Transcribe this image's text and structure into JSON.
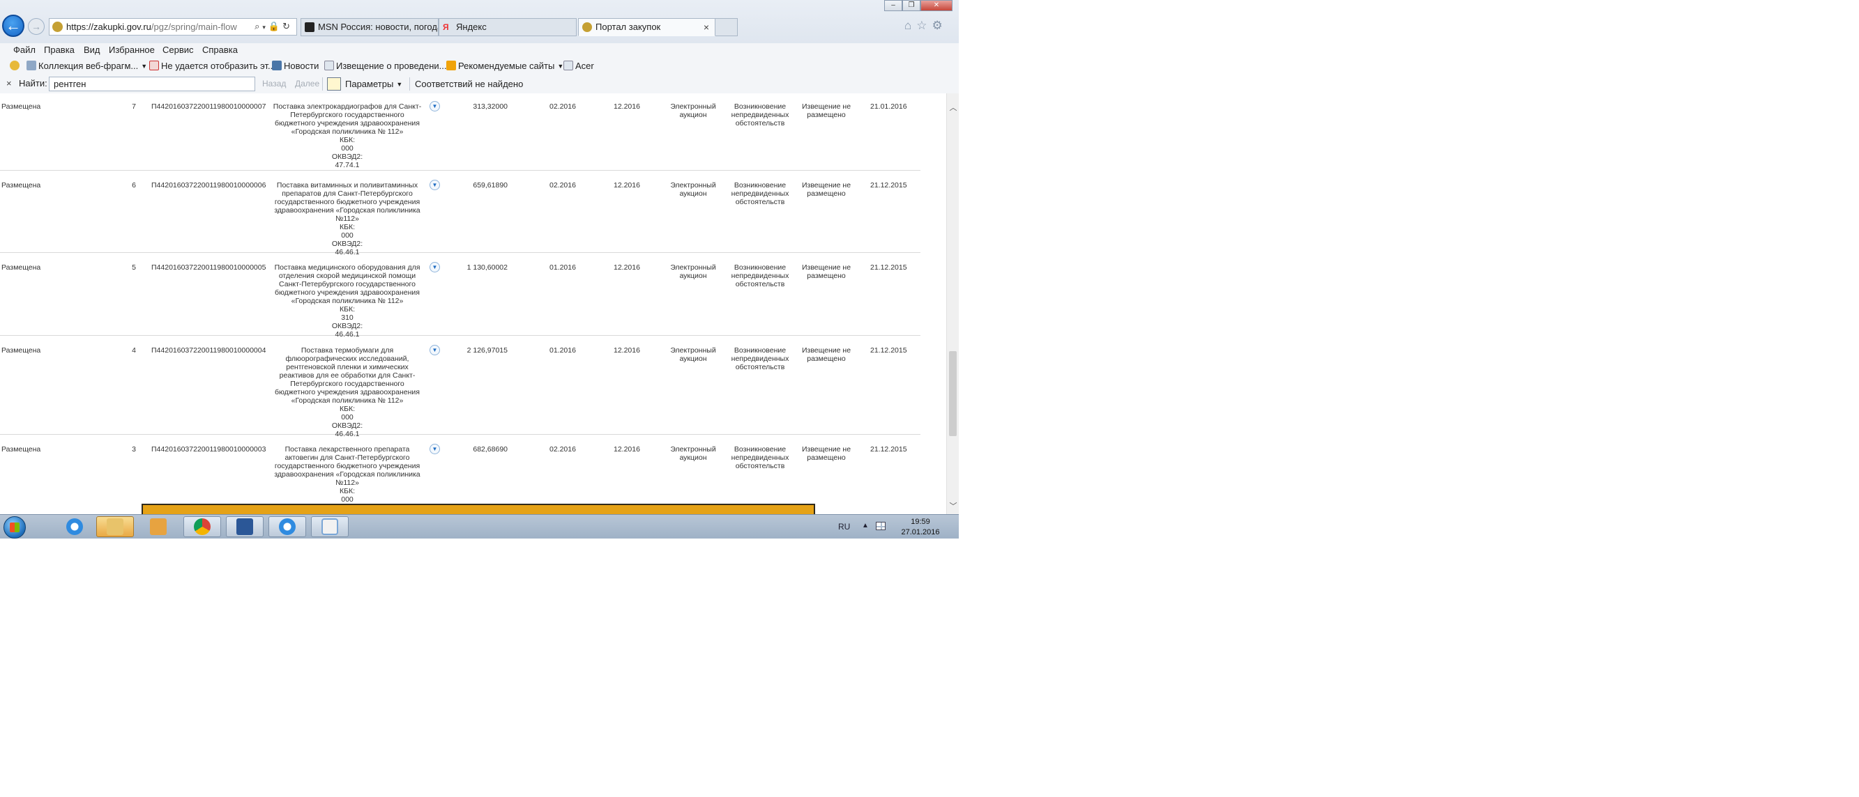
{
  "browser": {
    "address": {
      "host": "https://zakupki.gov.ru",
      "path": "/pgz/spring/main-flow"
    },
    "tabs": [
      {
        "label": "MSN Россия: новости, погода...",
        "active": false
      },
      {
        "label": "Яндекс",
        "active": false
      },
      {
        "label": "Портал закупок",
        "active": true,
        "close": "×"
      }
    ],
    "window_controls": {
      "minimize": "–",
      "restore": "❐",
      "close": "✕"
    }
  },
  "menu": [
    "Файл",
    "Правка",
    "Вид",
    "Избранное",
    "Сервис",
    "Справка"
  ],
  "favorites": [
    {
      "label": "Коллекция веб-фрагм...",
      "icon": "web-slice-icon",
      "dropdown": true
    },
    {
      "label": "Не удается отобразить эт...",
      "icon": "page-error-icon",
      "dropdown": false
    },
    {
      "label": "Новости",
      "icon": "vk-icon",
      "dropdown": false
    },
    {
      "label": "Извещение о проведени...",
      "icon": "page-icon",
      "dropdown": false
    },
    {
      "label": "Рекомендуемые сайты",
      "icon": "bing-icon",
      "dropdown": true
    },
    {
      "label": "Acer",
      "icon": "acer-icon",
      "dropdown": false
    }
  ],
  "find": {
    "close": "×",
    "label": "Найти:",
    "query": "рентген",
    "prev": "Назад",
    "next": "Далее",
    "options": "Параметры",
    "result": "Соответствий не найдено"
  },
  "rows": [
    {
      "status": "Размещена",
      "num": "7",
      "code": "П442016037220011980010000007",
      "desc": [
        "Поставка электрокардиографов для Санкт-Петербургского государственного бюджетного учреждения здравоохранения «Городская поликлиника № 112»",
        "КБК:",
        "000",
        "ОКВЭД2:",
        "47.74.1"
      ],
      "price": "313,32000",
      "d1": "02.2016",
      "d2": "12.2016",
      "way": "Электронный аукцион",
      "reason": "Возникновение непредвиденных обстоятельств",
      "notice": "Извещение не размещено",
      "date": "21.01.2016"
    },
    {
      "status": "Размещена",
      "num": "6",
      "code": "П442016037220011980010000006",
      "desc": [
        "Поставка витаминных и поливитаминных препаратов для Санкт-Петербургского государственного бюджетного учреждения здравоохранения «Городская поликлиника №112»",
        "КБК:",
        "000",
        "ОКВЭД2:",
        "46.46.1"
      ],
      "price": "659,61890",
      "d1": "02.2016",
      "d2": "12.2016",
      "way": "Электронный аукцион",
      "reason": "Возникновение непредвиденных обстоятельств",
      "notice": "Извещение не размещено",
      "date": "21.12.2015"
    },
    {
      "status": "Размещена",
      "num": "5",
      "code": "П442016037220011980010000005",
      "desc": [
        "Поставка медицинского оборудования для отделения скорой медицинской помощи Санкт-Петербургского государственного бюджетного учреждения здравоохранения «Городская поликлиника № 112»",
        "КБК:",
        "310",
        "ОКВЭД2:",
        "46.46.1"
      ],
      "price": "1 130,60002",
      "d1": "01.2016",
      "d2": "12.2016",
      "way": "Электронный аукцион",
      "reason": "Возникновение непредвиденных обстоятельств",
      "notice": "Извещение не размещено",
      "date": "21.12.2015"
    },
    {
      "status": "Размещена",
      "num": "4",
      "code": "П442016037220011980010000004",
      "desc": [
        "Поставка термобумаги для флюорографических исследований, рентгеновской пленки и химических реактивов для ее обработки для Санкт-Петербургского государственного бюджетного учреждения здравоохранения «Городская поликлиника № 112»",
        "КБК:",
        "000",
        "ОКВЭД2:",
        "46.46.1"
      ],
      "price": "2 126,97015",
      "d1": "01.2016",
      "d2": "12.2016",
      "way": "Электронный аукцион",
      "reason": "Возникновение непредвиденных обстоятельств",
      "notice": "Извещение не размещено",
      "date": "21.12.2015"
    },
    {
      "status": "Размещена",
      "num": "3",
      "code": "П442016037220011980010000003",
      "desc": [
        "Поставка лекарственного препарата актовегин для Санкт-Петербургского государственного бюджетного учреждения здравоохранения «Городская поликлиника №112»",
        "КБК:",
        "000"
      ],
      "price": "682,68690",
      "d1": "02.2016",
      "d2": "12.2016",
      "way": "Электронный аукцион",
      "reason": "Возникновение непредвиденных обстоятельств",
      "notice": "Извещение не размещено",
      "date": "21.12.2015"
    }
  ],
  "taskbar": {
    "lang": "RU",
    "time": "19:59",
    "date": "27.01.2016",
    "apps": [
      "internet-explorer-icon",
      "file-explorer-icon",
      "media-player-icon",
      "chrome-icon",
      "word-icon",
      "internet-explorer-icon",
      "paint-icon"
    ]
  }
}
